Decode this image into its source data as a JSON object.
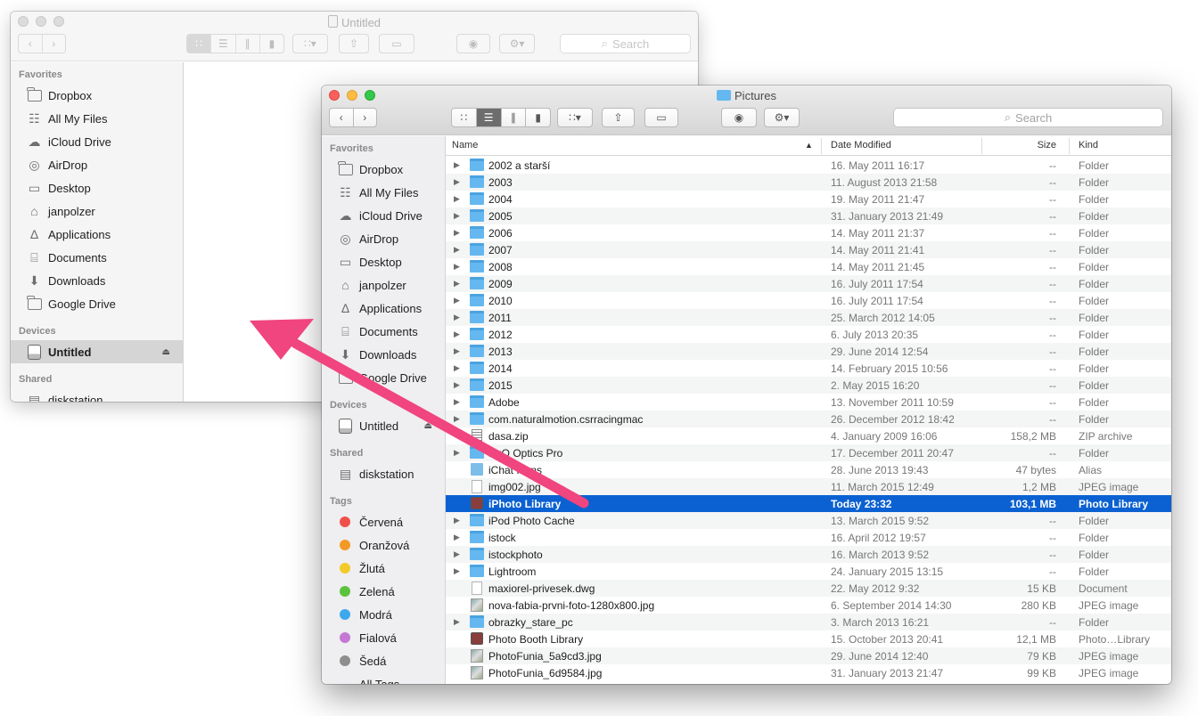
{
  "back_window": {
    "title": "Untitled",
    "search_placeholder": "Search",
    "sidebar": {
      "favorites_header": "Favorites",
      "favorites": [
        {
          "label": "Dropbox",
          "icon": "folder-icon"
        },
        {
          "label": "All My Files",
          "icon": "all-files-icon"
        },
        {
          "label": "iCloud Drive",
          "icon": "cloud-icon"
        },
        {
          "label": "AirDrop",
          "icon": "airdrop-icon"
        },
        {
          "label": "Desktop",
          "icon": "desktop-icon"
        },
        {
          "label": "janpolzer",
          "icon": "home-icon"
        },
        {
          "label": "Applications",
          "icon": "applications-icon"
        },
        {
          "label": "Documents",
          "icon": "documents-icon"
        },
        {
          "label": "Downloads",
          "icon": "downloads-icon"
        },
        {
          "label": "Google Drive",
          "icon": "folder-icon"
        }
      ],
      "devices_header": "Devices",
      "devices": [
        {
          "label": "Untitled",
          "icon": "disk-icon",
          "selected": true
        }
      ],
      "shared_header": "Shared",
      "shared": [
        {
          "label": "diskstation",
          "icon": "server-icon"
        }
      ]
    }
  },
  "front_window": {
    "title": "Pictures",
    "search_placeholder": "Search",
    "sidebar": {
      "favorites_header": "Favorites",
      "favorites": [
        {
          "label": "Dropbox",
          "icon": "folder-icon"
        },
        {
          "label": "All My Files",
          "icon": "all-files-icon"
        },
        {
          "label": "iCloud Drive",
          "icon": "cloud-icon"
        },
        {
          "label": "AirDrop",
          "icon": "airdrop-icon"
        },
        {
          "label": "Desktop",
          "icon": "desktop-icon"
        },
        {
          "label": "janpolzer",
          "icon": "home-icon"
        },
        {
          "label": "Applications",
          "icon": "applications-icon"
        },
        {
          "label": "Documents",
          "icon": "documents-icon"
        },
        {
          "label": "Downloads",
          "icon": "downloads-icon"
        },
        {
          "label": "Google Drive",
          "icon": "folder-icon"
        }
      ],
      "devices_header": "Devices",
      "devices": [
        {
          "label": "Untitled",
          "icon": "disk-icon"
        }
      ],
      "shared_header": "Shared",
      "shared": [
        {
          "label": "diskstation",
          "icon": "server-icon"
        }
      ],
      "tags_header": "Tags",
      "tags": [
        {
          "label": "Červená",
          "color": "#f0504a"
        },
        {
          "label": "Oranžová",
          "color": "#f39a26"
        },
        {
          "label": "Žlutá",
          "color": "#f2cb28"
        },
        {
          "label": "Zelená",
          "color": "#5ac23d"
        },
        {
          "label": "Modrá",
          "color": "#3ea8ec"
        },
        {
          "label": "Fialová",
          "color": "#c577d5"
        },
        {
          "label": "Šedá",
          "color": "#8e8e8e"
        },
        {
          "label": "All Tags…",
          "color": ""
        }
      ]
    },
    "columns": {
      "name": "Name",
      "date": "Date Modified",
      "size": "Size",
      "kind": "Kind"
    },
    "files": [
      {
        "name": "2002 a starší",
        "date": "16. May 2011 16:17",
        "size": "--",
        "kind": "Folder",
        "icon": "folder",
        "expandable": true
      },
      {
        "name": "2003",
        "date": "11. August 2013 21:58",
        "size": "--",
        "kind": "Folder",
        "icon": "folder",
        "expandable": true
      },
      {
        "name": "2004",
        "date": "19. May 2011 21:47",
        "size": "--",
        "kind": "Folder",
        "icon": "folder",
        "expandable": true
      },
      {
        "name": "2005",
        "date": "31. January 2013 21:49",
        "size": "--",
        "kind": "Folder",
        "icon": "folder",
        "expandable": true
      },
      {
        "name": "2006",
        "date": "14. May 2011 21:37",
        "size": "--",
        "kind": "Folder",
        "icon": "folder",
        "expandable": true
      },
      {
        "name": "2007",
        "date": "14. May 2011 21:41",
        "size": "--",
        "kind": "Folder",
        "icon": "folder",
        "expandable": true
      },
      {
        "name": "2008",
        "date": "14. May 2011 21:45",
        "size": "--",
        "kind": "Folder",
        "icon": "folder",
        "expandable": true
      },
      {
        "name": "2009",
        "date": "16. July 2011 17:54",
        "size": "--",
        "kind": "Folder",
        "icon": "folder",
        "expandable": true
      },
      {
        "name": "2010",
        "date": "16. July 2011 17:54",
        "size": "--",
        "kind": "Folder",
        "icon": "folder",
        "expandable": true
      },
      {
        "name": "2011",
        "date": "25. March 2012 14:05",
        "size": "--",
        "kind": "Folder",
        "icon": "folder",
        "expandable": true
      },
      {
        "name": "2012",
        "date": "6. July 2013 20:35",
        "size": "--",
        "kind": "Folder",
        "icon": "folder",
        "expandable": true
      },
      {
        "name": "2013",
        "date": "29. June 2014 12:54",
        "size": "--",
        "kind": "Folder",
        "icon": "folder",
        "expandable": true
      },
      {
        "name": "2014",
        "date": "14. February 2015 10:56",
        "size": "--",
        "kind": "Folder",
        "icon": "folder",
        "expandable": true
      },
      {
        "name": "2015",
        "date": "2. May 2015 16:20",
        "size": "--",
        "kind": "Folder",
        "icon": "folder",
        "expandable": true
      },
      {
        "name": "Adobe",
        "date": "13. November 2011 10:59",
        "size": "--",
        "kind": "Folder",
        "icon": "folder",
        "expandable": true
      },
      {
        "name": "com.naturalmotion.csrracingmac",
        "date": "26. December 2012 18:42",
        "size": "--",
        "kind": "Folder",
        "icon": "folder",
        "expandable": true
      },
      {
        "name": "dasa.zip",
        "date": "4. January 2009 16:06",
        "size": "158,2 MB",
        "kind": "ZIP archive",
        "icon": "zip",
        "expandable": false
      },
      {
        "name": "DxO Optics Pro",
        "date": "17. December 2011 20:47",
        "size": "--",
        "kind": "Folder",
        "icon": "folder",
        "expandable": true
      },
      {
        "name": "iChat Icons",
        "date": "28. June 2013 19:43",
        "size": "47 bytes",
        "kind": "Alias",
        "icon": "alias",
        "expandable": false
      },
      {
        "name": "img002.jpg",
        "date": "11. March 2015 12:49",
        "size": "1,2 MB",
        "kind": "JPEG image",
        "icon": "file",
        "expandable": false
      },
      {
        "name": "iPhoto Library",
        "date": "Today 23:32",
        "size": "103,1 MB",
        "kind": "Photo Library",
        "icon": "app",
        "expandable": false,
        "selected": true
      },
      {
        "name": "iPod Photo Cache",
        "date": "13. March 2015 9:52",
        "size": "--",
        "kind": "Folder",
        "icon": "folder",
        "expandable": true
      },
      {
        "name": "istock",
        "date": "16. April 2012 19:57",
        "size": "--",
        "kind": "Folder",
        "icon": "folder",
        "expandable": true
      },
      {
        "name": "istockphoto",
        "date": "16. March 2013 9:52",
        "size": "--",
        "kind": "Folder",
        "icon": "folder",
        "expandable": true
      },
      {
        "name": "Lightroom",
        "date": "24. January 2015 13:15",
        "size": "--",
        "kind": "Folder",
        "icon": "folder",
        "expandable": true
      },
      {
        "name": "maxiorel-privesek.dwg",
        "date": "22. May 2012 9:32",
        "size": "15 KB",
        "kind": "Document",
        "icon": "file",
        "expandable": false
      },
      {
        "name": "nova-fabia-prvni-foto-1280x800.jpg",
        "date": "6. September 2014 14:30",
        "size": "280 KB",
        "kind": "JPEG image",
        "icon": "image",
        "expandable": false
      },
      {
        "name": "obrazky_stare_pc",
        "date": "3. March 2013 16:21",
        "size": "--",
        "kind": "Folder",
        "icon": "folder",
        "expandable": true
      },
      {
        "name": "Photo Booth Library",
        "date": "15. October 2013 20:41",
        "size": "12,1 MB",
        "kind": "Photo…Library",
        "icon": "app",
        "expandable": false
      },
      {
        "name": "PhotoFunia_5a9cd3.jpg",
        "date": "29. June 2014 12:40",
        "size": "79 KB",
        "kind": "JPEG image",
        "icon": "image",
        "expandable": false
      },
      {
        "name": "PhotoFunia_6d9584.jpg",
        "date": "31. January 2013 21:47",
        "size": "99 KB",
        "kind": "JPEG image",
        "icon": "image",
        "expandable": false
      }
    ]
  },
  "colors": {
    "selection": "#0b61d1",
    "folder": "#65b8ef",
    "arrow": "#f0457e"
  }
}
